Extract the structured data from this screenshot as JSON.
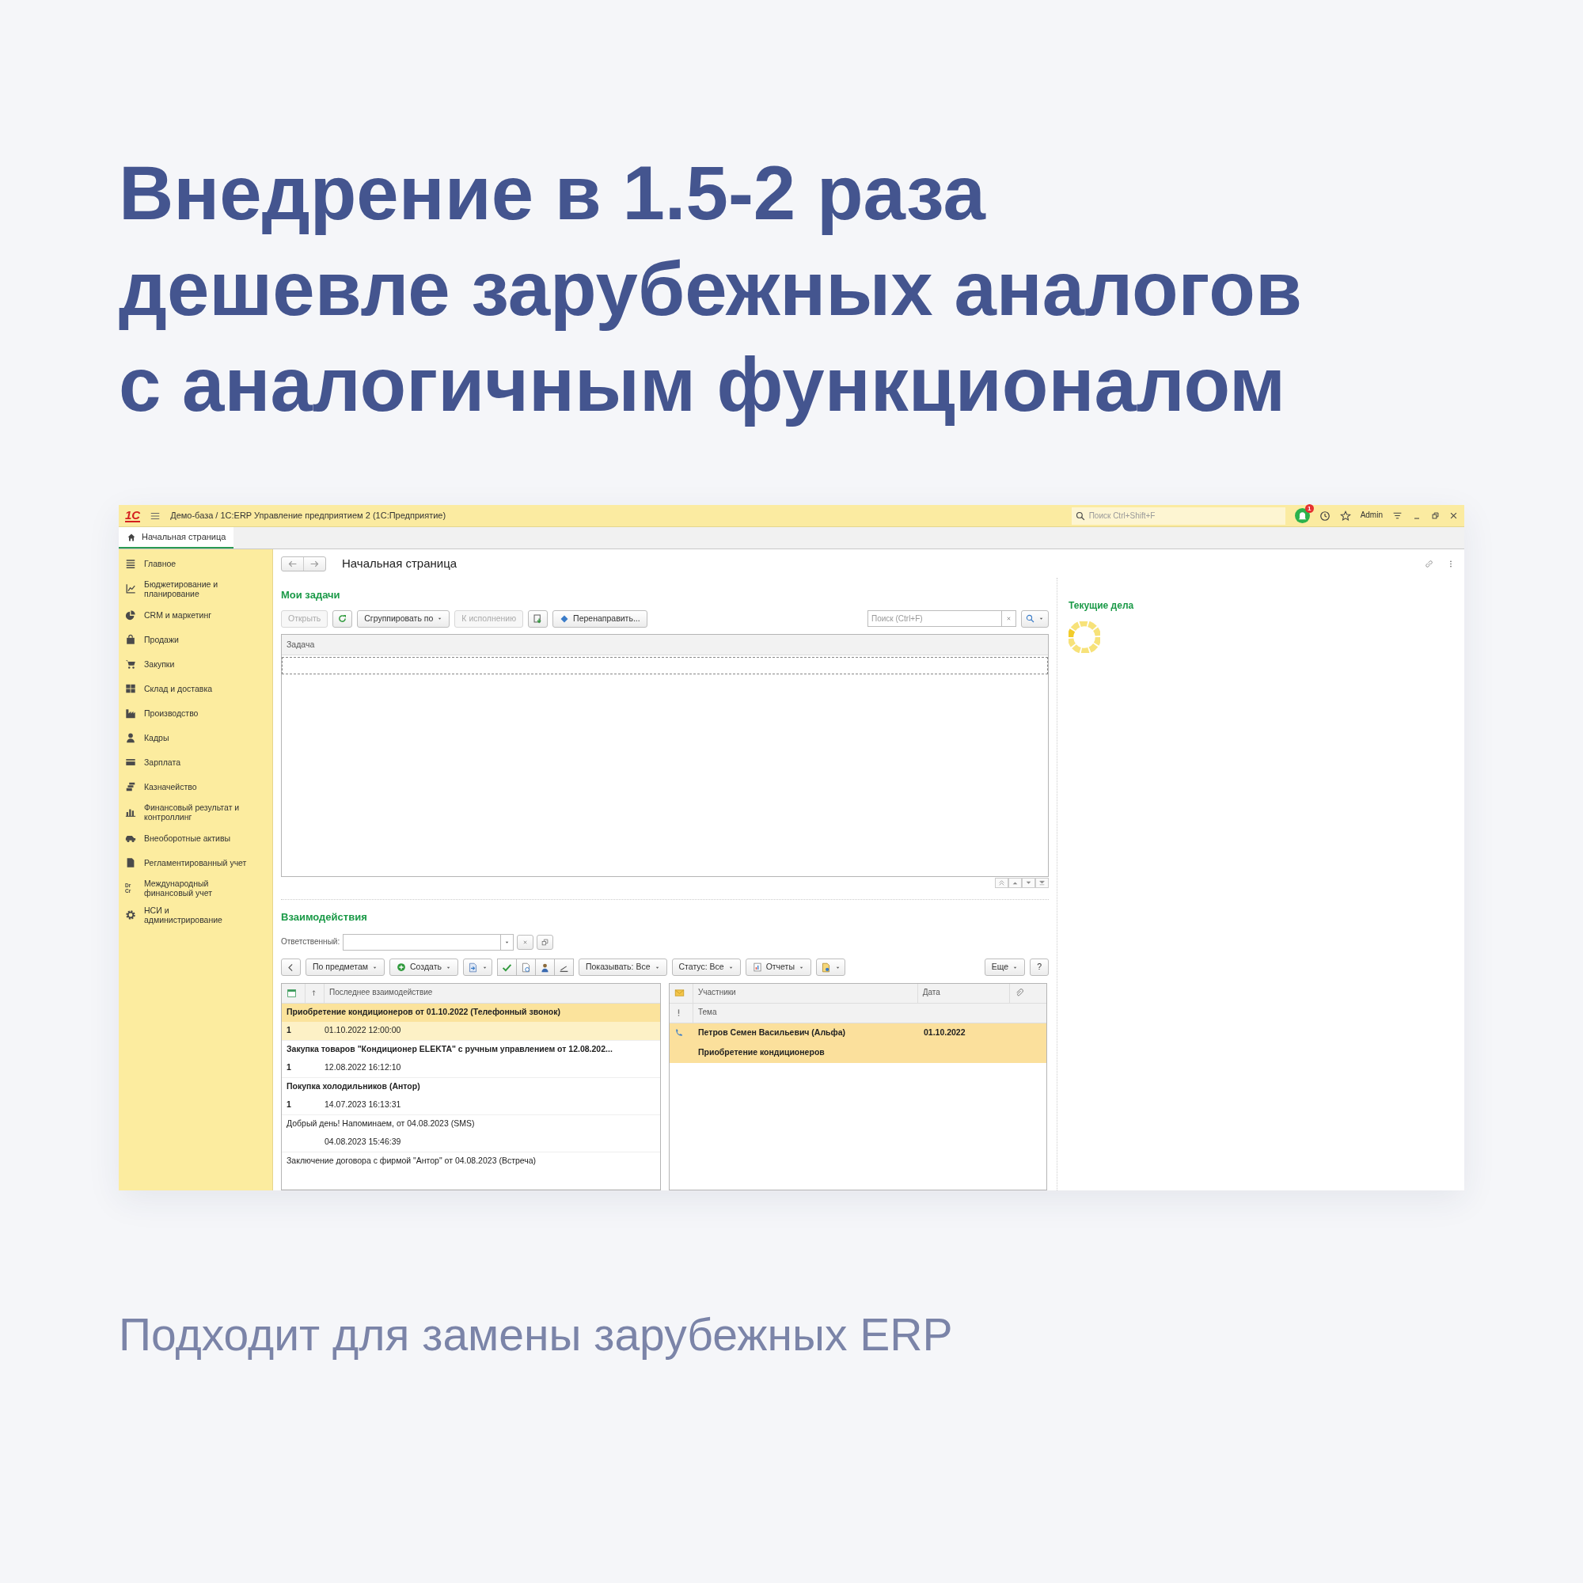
{
  "headline_lines": [
    "Внедрение в 1.5-2 раза",
    "дешевле зарубежных аналогов",
    "с аналогичным функционалом"
  ],
  "app": {
    "title_bar": {
      "logo": "1С",
      "title": "Демо-база / 1С:ERP Управление предприятием 2  (1С:Предприятие)",
      "search_placeholder": "Поиск Ctrl+Shift+F",
      "notification_count": "1",
      "user": "Admin"
    },
    "open_tabs": [
      {
        "label": "Начальная страница",
        "selected": true
      }
    ],
    "sidebar": [
      {
        "label": "Главное"
      },
      {
        "label": "Бюджетирование и\nпланирование"
      },
      {
        "label": "CRM и маркетинг"
      },
      {
        "label": "Продажи"
      },
      {
        "label": "Закупки"
      },
      {
        "label": "Склад и доставка"
      },
      {
        "label": "Производство"
      },
      {
        "label": "Кадры"
      },
      {
        "label": "Зарплата"
      },
      {
        "label": "Казначейство"
      },
      {
        "label": "Финансовый результат и\nконтроллинг"
      },
      {
        "label": "Внеоборотные активы"
      },
      {
        "label": "Регламентированный учет"
      },
      {
        "label": "Международный\nфинансовый учет",
        "icon_label": "Dr\nCr"
      },
      {
        "label": "НСИ и\nадминистрирование"
      }
    ],
    "page_title": "Начальная страница",
    "my_tasks": {
      "title": "Мои задачи",
      "toolbar": [
        {
          "kind": "button",
          "label": "Открыть",
          "disabled": true
        },
        {
          "kind": "icon"
        },
        {
          "kind": "dropdown",
          "label": "Сгруппировать по"
        },
        {
          "kind": "button",
          "label": "К исполнению",
          "disabled": true
        },
        {
          "kind": "icon"
        },
        {
          "kind": "button",
          "label": "Перенаправить...",
          "disabled": false
        }
      ],
      "search_placeholder": "Поиск (Ctrl+F)",
      "columns": [
        "Задача"
      ]
    },
    "interactions": {
      "title": "Взаимодействия",
      "responsible_label": "Ответственный:",
      "toolbar": [
        {
          "kind": "icon"
        },
        {
          "kind": "dropdown",
          "label": "По предметам"
        },
        {
          "kind": "dropdown",
          "label": "Создать"
        },
        {
          "kind": "icon_dropdown"
        },
        {
          "kind": "segment"
        },
        {
          "kind": "segment"
        },
        {
          "kind": "segment"
        },
        {
          "kind": "segment"
        },
        {
          "kind": "dropdown",
          "label": "Показывать: Все"
        },
        {
          "kind": "dropdown",
          "label": "Статус: Все"
        },
        {
          "kind": "dropdown",
          "label": "Отчеты"
        },
        {
          "kind": "icon_dropdown"
        }
      ],
      "toolbar_right": [
        {
          "kind": "dropdown",
          "label": "Еще"
        },
        {
          "kind": "button",
          "label": "?",
          "disabled": false
        }
      ],
      "list_column": "Последнее взаимодействие",
      "rows": [
        {
          "title": "Приобретение кондиционеров от 01.10.2022 (Телефонный звонок)",
          "bold": true,
          "count": "1",
          "time": "01.10.2022 12:00:00",
          "selected": true
        },
        {
          "title": "Закупка товаров \"Кондиционер ELEKTA\" с ручным управлением от 12.08.202...",
          "bold": true,
          "count": "1",
          "time": "12.08.2022 16:12:10",
          "selected": false
        },
        {
          "title": "Покупка холодильников (Антор)",
          "bold": true,
          "count": "1",
          "time": "14.07.2023 16:13:31",
          "selected": false
        },
        {
          "title": "Добрый день! Напоминаем, от 04.08.2023 (SMS)",
          "bold": false,
          "time": "04.08.2023 15:46:39",
          "selected": false
        },
        {
          "title": "Заключение договора с фирмой \"Антор\" от 04.08.2023 (Встреча)",
          "bold": false,
          "selected": false
        }
      ],
      "detail_columns": [
        "Участники",
        "Дата"
      ],
      "detail_subcolumn": "Тема",
      "detail_rows": [
        {
          "participants": "Петров Семен Васильевич (Альфа)",
          "date": "01.10.2022",
          "topic": "Приобретение кондиционеров",
          "selected": true
        }
      ]
    },
    "current_affairs": {
      "title": "Текущие дела"
    }
  },
  "subtitle": "Подходит для замены зарубежных ERP"
}
